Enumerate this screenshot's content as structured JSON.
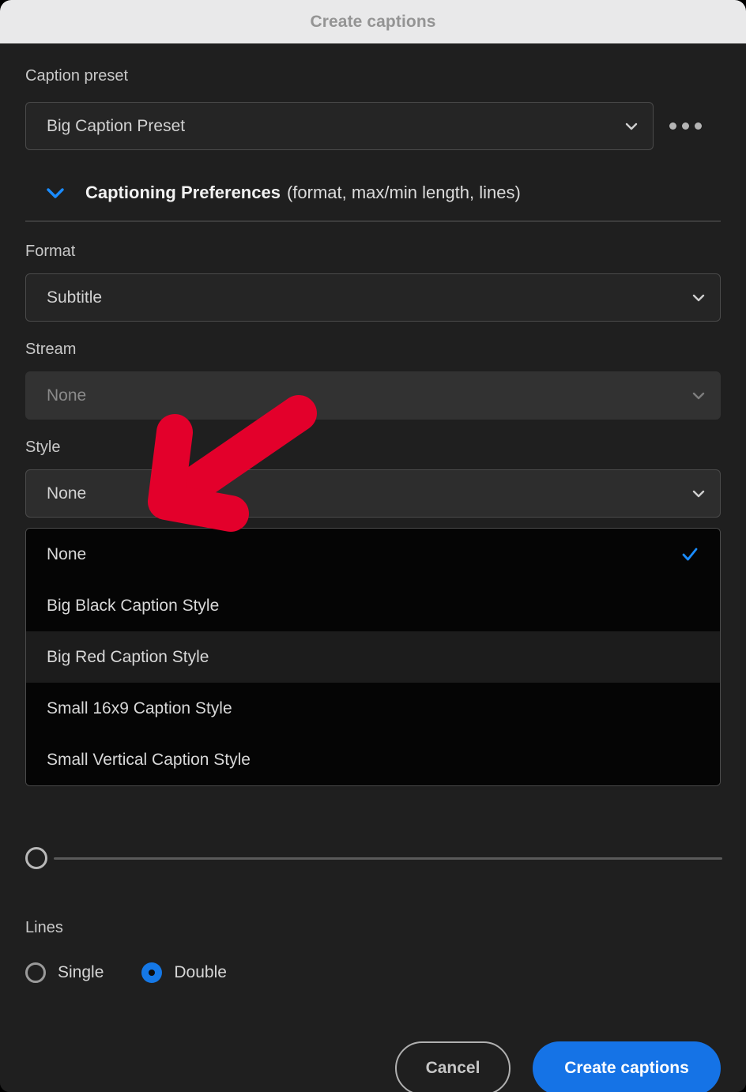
{
  "window": {
    "title": "Create captions"
  },
  "caption_preset": {
    "label": "Caption preset",
    "value": "Big Caption Preset",
    "chevron_icon": "chevron-down-icon",
    "overflow_icon": "more-options-icon"
  },
  "preferences": {
    "title": "Captioning Preferences",
    "subtitle": "(format, max/min length, lines)",
    "expanded_icon": "chevron-down-icon"
  },
  "format": {
    "label": "Format",
    "value": "Subtitle"
  },
  "stream": {
    "label": "Stream",
    "value": "None",
    "disabled": true
  },
  "style": {
    "label": "Style",
    "value": "None",
    "options": [
      {
        "label": "None",
        "selected": true,
        "hovered": false
      },
      {
        "label": "Big Black Caption Style",
        "selected": false,
        "hovered": false
      },
      {
        "label": "Big Red Caption Style",
        "selected": false,
        "hovered": true
      },
      {
        "label": "Small 16x9 Caption Style",
        "selected": false,
        "hovered": false
      },
      {
        "label": "Small Vertical Caption Style",
        "selected": false,
        "hovered": false
      }
    ],
    "check_icon": "checkmark-icon"
  },
  "slider": {
    "name": "length-slider",
    "value_percent": 0
  },
  "lines": {
    "label": "Lines",
    "options": [
      {
        "label": "Single",
        "selected": false
      },
      {
        "label": "Double",
        "selected": true
      }
    ]
  },
  "footer": {
    "cancel_label": "Cancel",
    "create_label": "Create captions"
  },
  "annotation": {
    "arrow_icon": "red-arrow-pointing-down-left",
    "color": "#e3002b"
  },
  "colors": {
    "accent_blue": "#1573e6",
    "titlebar_bg": "#e9e9ea",
    "dialog_bg": "#1f1f1f",
    "dropdown_bg": "#050505",
    "annotation_red": "#e3002b"
  }
}
